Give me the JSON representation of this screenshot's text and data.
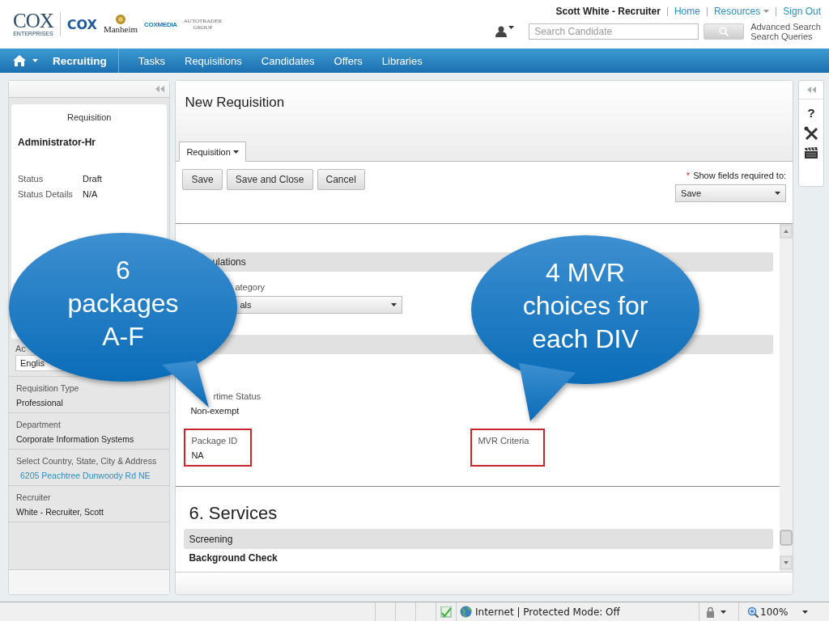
{
  "header": {
    "logos": [
      {
        "kind": "enterprises",
        "text": "COX",
        "sub": "ENTERPRISES"
      },
      {
        "kind": "cox",
        "text": "COX"
      },
      {
        "kind": "manheim",
        "text": "Manheim"
      },
      {
        "kind": "media",
        "text": "COXMEDIA"
      },
      {
        "kind": "autotrader",
        "text": "AUTOTRADER",
        "sub": "GROUP"
      }
    ],
    "user": "Scott White - Recruiter",
    "links": [
      {
        "label": "Home",
        "dropdown": false
      },
      {
        "label": "Resources",
        "dropdown": true
      },
      {
        "label": "Sign Out",
        "dropdown": false
      }
    ],
    "search": {
      "placeholder": "Search Candidate"
    },
    "search_links": [
      "Advanced Search",
      "Search Queries"
    ]
  },
  "navbar": {
    "module": "Recruiting",
    "items": [
      "Tasks",
      "Requisitions",
      "Candidates",
      "Offers",
      "Libraries"
    ]
  },
  "left_panel": {
    "card": {
      "title": "Requisition",
      "name": "Administrator-Hr",
      "fields": [
        {
          "label": "Status",
          "value": "Draft"
        },
        {
          "label": "Status Details",
          "value": "N/A"
        }
      ]
    },
    "partial_field": {
      "label": "Ac",
      "value": "Englis"
    },
    "fields": [
      {
        "label": "Requisition Type",
        "value": "Professional",
        "kind": "text"
      },
      {
        "label": "Department",
        "value": "Corporate Information Systems",
        "kind": "text"
      },
      {
        "label": "Select Country, State, City & Address",
        "value": "6205 Peachtree Dunwoody Rd NE",
        "kind": "link"
      },
      {
        "label": "Recruiter",
        "value": "White - Recruiter, Scott",
        "kind": "text"
      }
    ]
  },
  "main": {
    "title": "New Requisition",
    "tabs": [
      {
        "label": "Requisition",
        "selected": true
      }
    ],
    "buttons": [
      "Save",
      "Save and Close",
      "Cancel"
    ],
    "required_mark": "*",
    "required_label": "Show fields required to:",
    "required_select": "Save",
    "content": [
      {
        "kind": "section",
        "title": "ulations"
      },
      {
        "kind": "select",
        "label": "ategory",
        "value": "als"
      },
      {
        "kind": "section"
      },
      {
        "kind": "text_field",
        "label": "rtime Status",
        "value": "Non-exempt"
      },
      {
        "kind": "field_row",
        "fields": [
          {
            "label": "Package ID",
            "value": "NA",
            "highlighted": true
          },
          {
            "label": "MVR Criteria",
            "highlighted": true
          }
        ]
      },
      {
        "kind": "divider"
      },
      {
        "kind": "heading",
        "title": "6. Services"
      },
      {
        "kind": "section",
        "title": "Screening"
      },
      {
        "kind": "subheading",
        "title": "Background Check"
      }
    ]
  },
  "toolbar": {
    "help": "?"
  },
  "callouts": [
    {
      "text": "6 packages A-F"
    },
    {
      "text": "4 MVR choices for each DIV"
    }
  ],
  "status_bar": {
    "zone": "Internet | Protected Mode: Off",
    "zoom": "100%"
  }
}
